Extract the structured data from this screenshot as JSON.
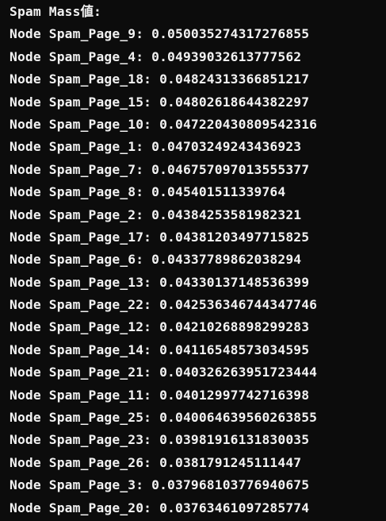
{
  "terminal": {
    "header": "Spam Mass値:",
    "lines": [
      "Node Spam_Page_9: 0.050035274317276855",
      "Node Spam_Page_4: 0.04939032613777562",
      "Node Spam_Page_18: 0.04824313366851217",
      "Node Spam_Page_15: 0.04802618644382297",
      "Node Spam_Page_10: 0.047220430809542316",
      "Node Spam_Page_1: 0.04703249243436923",
      "Node Spam_Page_7: 0.046757097013555377",
      "Node Spam_Page_8: 0.045401511339764",
      "Node Spam_Page_2: 0.04384253581982321",
      "Node Spam_Page_17: 0.04381203497715825",
      "Node Spam_Page_6: 0.04337789862038294",
      "Node Spam_Page_13: 0.04330137148536399",
      "Node Spam_Page_22: 0.042536346744347746",
      "Node Spam_Page_12: 0.04210268898299283",
      "Node Spam_Page_14: 0.04116548573034595",
      "Node Spam_Page_21: 0.040326263951723444",
      "Node Spam_Page_11: 0.04012997742716398",
      "Node Spam_Page_25: 0.040064639560263855",
      "Node Spam_Page_23: 0.03981916131830035",
      "Node Spam_Page_26: 0.0381791245111447",
      "Node Spam_Page_3: 0.037968103776940675",
      "Node Spam_Page_20: 0.03763461097285774"
    ]
  },
  "colors": {
    "background": "#0c0c0c",
    "text": "#f2f2f2"
  }
}
